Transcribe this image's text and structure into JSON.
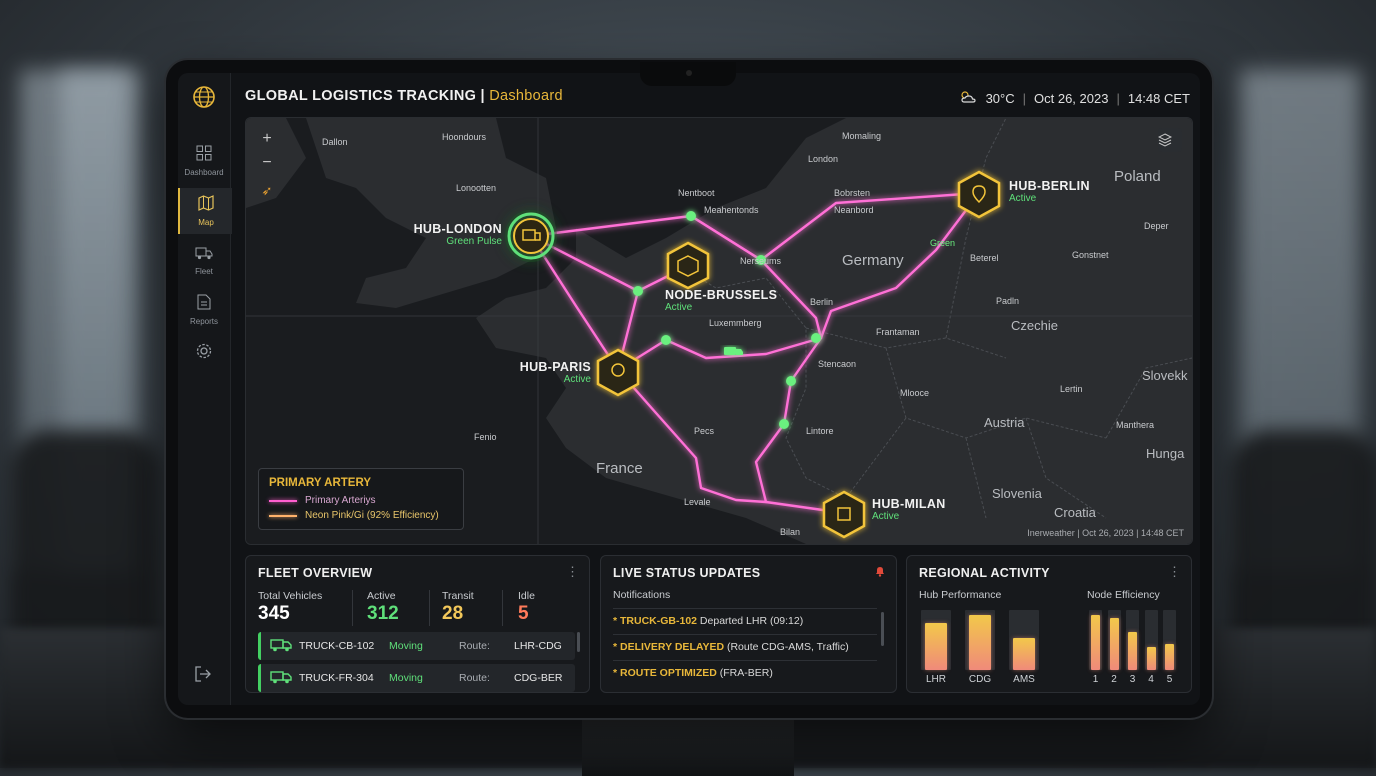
{
  "header": {
    "title": "GLOBAL LOGISTICS TRACKING",
    "separator": " | ",
    "subtitle": "Dashboard",
    "temperature": "30°C",
    "date": "Oct 26, 2023",
    "time": "14:48 CET"
  },
  "sidebar": {
    "items": [
      {
        "label": "Dashboard",
        "icon": "grid-icon"
      },
      {
        "label": "Map",
        "icon": "map-icon"
      },
      {
        "label": "Fleet",
        "icon": "truck-icon"
      },
      {
        "label": "Reports",
        "icon": "document-icon"
      },
      {
        "label": "",
        "icon": "gear-icon"
      }
    ],
    "active": "Map"
  },
  "map": {
    "places": [
      "Hoondours",
      "Dallon",
      "Momaling",
      "London",
      "Poland",
      "Lonootten",
      "Nentboot",
      "Meahentonds",
      "Bobrsten",
      "Neanbord",
      "Deper",
      "Germany",
      "Nerseums",
      "Gonstnet",
      "Beterel",
      "Berlin",
      "Padln",
      "Luxemmberg",
      "Frantaman",
      "Czechie",
      "Stencaon",
      "Slovekk",
      "Mlooce",
      "Lertin",
      "Austria",
      "Manthera",
      "Pecs",
      "Lintore",
      "Fenio",
      "Hunga",
      "France",
      "Slovenia",
      "Levale",
      "Croatia",
      "Bilan",
      "Green"
    ],
    "hubs": [
      {
        "name": "HUB-LONDON",
        "status": "Green Pulse"
      },
      {
        "name": "NODE-BRUSSELS",
        "status": "Active"
      },
      {
        "name": "HUB-PARIS",
        "status": "Active"
      },
      {
        "name": "HUB-BERLIN",
        "status": "Active"
      },
      {
        "name": "HUB-MILAN",
        "status": "Active"
      }
    ],
    "legend": {
      "title": "PRIMARY ARTERY",
      "items": [
        "Primary Arteriys",
        "Neon Pink/Gi (92% Efficiency)"
      ],
      "colors": [
        "#ff5fd0",
        "#ffb26b"
      ]
    },
    "attribution": "Inerweather | Oct 26, 2023 | 14:48 CET",
    "colors": {
      "route": "#ff6fd6",
      "node": "#5fe07a",
      "hub": "#f2c43a"
    }
  },
  "fleet": {
    "title": "FLEET OVERVIEW",
    "stats": [
      {
        "label": "Total Vehicles",
        "value": "345",
        "color": "#ffffff"
      },
      {
        "label": "Active",
        "value": "312",
        "color": "#5fe07a"
      },
      {
        "label": "Transit",
        "value": "28",
        "color": "#f2c75a"
      },
      {
        "label": "Idle",
        "value": "5",
        "color": "#ff7a5a"
      }
    ],
    "trucks": [
      {
        "id": "TRUCK-CB-102",
        "status": "Moving",
        "route_label": "Route:",
        "route": "LHR-CDG"
      },
      {
        "id": "TRUCK-FR-304",
        "status": "Moving",
        "route_label": "Route:",
        "route": "CDG-BER"
      }
    ]
  },
  "live": {
    "title": "LIVE STATUS UPDATES",
    "subtitle": "Notifications",
    "items": [
      {
        "highlight": "* TRUCK-GB-102",
        "text": " Departed LHR (09:12)"
      },
      {
        "highlight": "* DELIVERY DELAYED",
        "text": " (Route CDG-AMS, Traffic)"
      },
      {
        "highlight": "* ROUTE OPTIMIZED",
        "text": " (FRA-BER)"
      }
    ]
  },
  "regional": {
    "title": "REGIONAL ACTIVITY",
    "hub_title": "Hub Performance",
    "node_title": "Node Efficiency"
  },
  "chart_data": [
    {
      "type": "bar",
      "title": "Hub Performance",
      "categories": [
        "LHR",
        "CDG",
        "AMS"
      ],
      "values": [
        0.78,
        0.92,
        0.54
      ]
    },
    {
      "type": "bar",
      "title": "Node Efficiency",
      "categories": [
        "1",
        "2",
        "3",
        "4",
        "5"
      ],
      "values": [
        0.92,
        0.86,
        0.64,
        0.39,
        0.43
      ]
    }
  ]
}
